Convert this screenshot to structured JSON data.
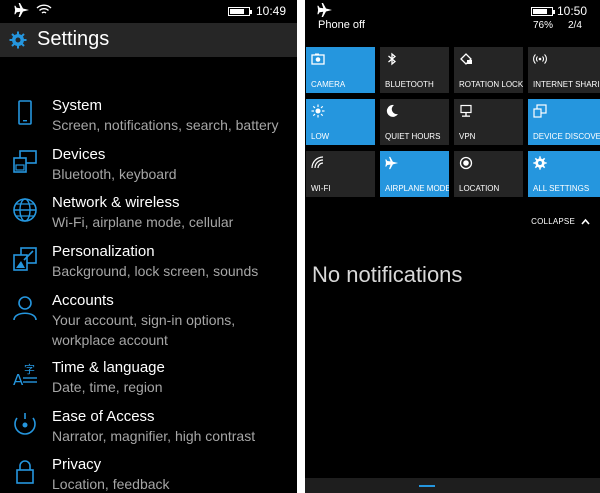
{
  "left": {
    "status": {
      "time": "10:49",
      "battery_level": 0.8
    },
    "header": {
      "title": "Settings"
    },
    "items": [
      {
        "name": "System",
        "desc": "Screen, notifications, search, battery",
        "icon": "phone-icon"
      },
      {
        "name": "Devices",
        "desc": "Bluetooth, keyboard",
        "icon": "devices-icon"
      },
      {
        "name": "Network & wireless",
        "desc": "Wi-Fi, airplane mode, cellular",
        "icon": "globe-icon"
      },
      {
        "name": "Personalization",
        "desc": "Background, lock screen, sounds",
        "icon": "personalization-icon"
      },
      {
        "name": "Accounts",
        "desc": "Your account, sign-in options, workplace account",
        "icon": "person-icon"
      },
      {
        "name": "Time & language",
        "desc": "Date, time, region",
        "icon": "time-language-icon"
      },
      {
        "name": "Ease of Access",
        "desc": "Narrator, magnifier, high contrast",
        "icon": "ease-of-access-icon"
      },
      {
        "name": "Privacy",
        "desc": "Location, feedback",
        "icon": "privacy-lock-icon"
      }
    ]
  },
  "right": {
    "status": {
      "phone_off": "Phone off",
      "time": "10:50",
      "battery_pct": "76%",
      "sim": "2/4",
      "battery_level": 0.76
    },
    "tiles": [
      {
        "label": "CAMERA",
        "on": true,
        "icon": "camera-icon"
      },
      {
        "label": "BLUETOOTH",
        "on": false,
        "icon": "bluetooth-icon"
      },
      {
        "label": "ROTATION LOCK",
        "on": false,
        "icon": "rotation-lock-icon"
      },
      {
        "label": "INTERNET SHARING",
        "on": false,
        "icon": "internet-sharing-icon"
      },
      {
        "label": "LOW",
        "on": true,
        "icon": "brightness-icon"
      },
      {
        "label": "QUIET HOURS",
        "on": false,
        "icon": "moon-icon"
      },
      {
        "label": "VPN",
        "on": false,
        "icon": "vpn-icon"
      },
      {
        "label": "DEVICE DISCOVERY",
        "on": true,
        "icon": "device-discovery-icon"
      },
      {
        "label": "WI-FI",
        "on": false,
        "icon": "wifi-icon"
      },
      {
        "label": "AIRPLANE MODE",
        "on": true,
        "icon": "airplane-icon"
      },
      {
        "label": "LOCATION",
        "on": false,
        "icon": "location-icon"
      },
      {
        "label": "ALL SETTINGS",
        "on": true,
        "icon": "gear-icon"
      }
    ],
    "collapse": "COLLAPSE",
    "no_notifications": "No notifications"
  },
  "colors": {
    "accent": "#2596de",
    "tile_off": "#252525",
    "header_bg": "#262626",
    "subtext": "#a6a6a6"
  }
}
